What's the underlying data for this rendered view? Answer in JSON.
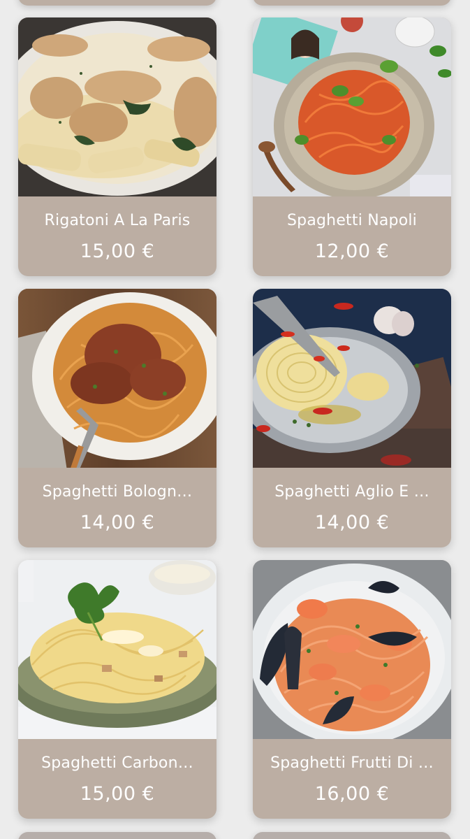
{
  "colors": {
    "background": "#ececec",
    "card_footer": "#bcaea3",
    "text": "#ffffff"
  },
  "menu": {
    "items": [
      {
        "name": "Rigatoni A La Paris",
        "price": "15,00 €",
        "image_icon": "creamy-chicken-rigatoni-photo"
      },
      {
        "name": "Spaghetti Napoli",
        "price": "12,00 €",
        "image_icon": "tomato-spaghetti-photo"
      },
      {
        "name": "Spaghetti Bologn…",
        "price": "14,00 €",
        "image_icon": "bolognese-spaghetti-photo"
      },
      {
        "name": "Spaghetti Aglio E …",
        "price": "14,00 €",
        "image_icon": "aglio-olio-spaghetti-photo"
      },
      {
        "name": "Spaghetti Carbon…",
        "price": "15,00 €",
        "image_icon": "carbonara-spaghetti-photo"
      },
      {
        "name": "Spaghetti Frutti Di …",
        "price": "16,00 €",
        "image_icon": "seafood-spaghetti-photo"
      }
    ]
  }
}
